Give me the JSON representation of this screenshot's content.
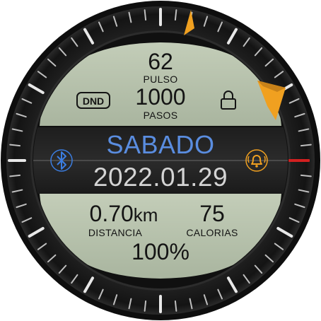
{
  "watch": {
    "pulse": {
      "value": "62",
      "label": "PULSO"
    },
    "steps": {
      "value": "1000",
      "label": "PASOS"
    },
    "dnd_label": "DND",
    "day": "SABADO",
    "date": "2022.01.29",
    "distance": {
      "value": "0.70",
      "unit": "km",
      "label": "DISTANCIA"
    },
    "calories": {
      "value": "75",
      "label": "CALORIAS"
    },
    "battery": "100%",
    "icons": [
      "lock-icon",
      "bluetooth-icon",
      "alarm-bell-icon"
    ],
    "colors": {
      "lcd": "#b7c2ad",
      "bezel": "#1b1b1b",
      "day_text": "#5a8de0",
      "date_text": "#d4d4d4",
      "accent_orange": "#f0a020",
      "marker_red": "#d22020",
      "bluetooth": "#3b7de0"
    }
  }
}
